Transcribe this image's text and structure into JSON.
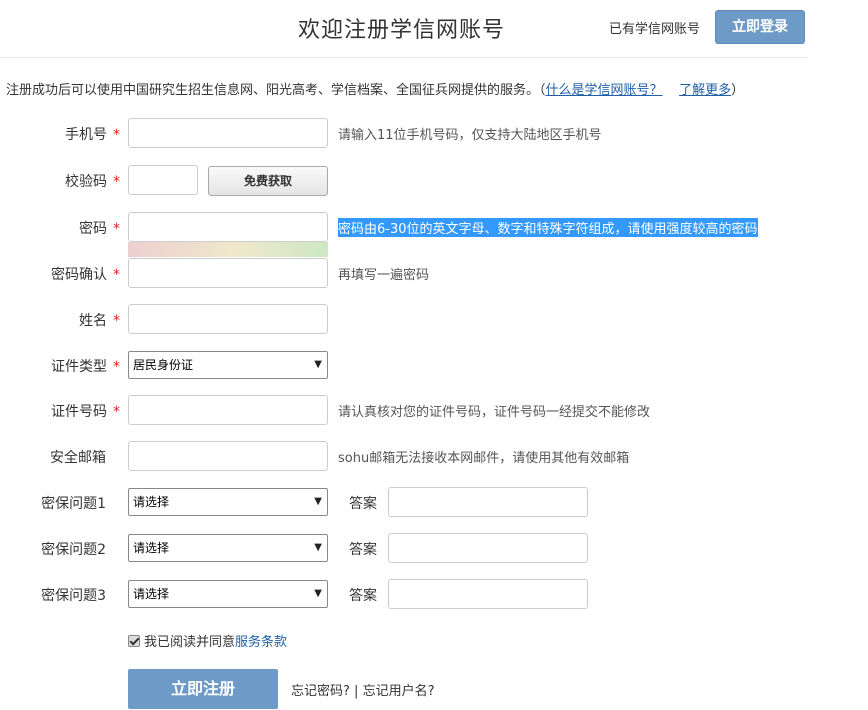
{
  "header": {
    "title": "欢迎注册学信网账号",
    "has_account": "已有学信网账号",
    "login_label": "立即登录"
  },
  "intro": {
    "text": "注册成功后可以使用中国研究生招生信息网、阳光高考、学信档案、全国征兵网提供的服务。（",
    "link_what": "什么是学信网账号？",
    "link_more": "了解更多",
    "close_paren": "）"
  },
  "form": {
    "phone": {
      "label": "手机号",
      "hint": "请输入11位手机号码，仅支持大陆地区手机号"
    },
    "code": {
      "label": "校验码",
      "button": "免费获取"
    },
    "password": {
      "label": "密码",
      "hint": "密码由6-30位的英文字母、数字和特殊字符组成，请使用强度较高的密码"
    },
    "password_confirm": {
      "label": "密码确认",
      "hint": "再填写一遍密码"
    },
    "name": {
      "label": "姓名"
    },
    "id_type": {
      "label": "证件类型",
      "selected": "居民身份证"
    },
    "id_number": {
      "label": "证件号码",
      "hint": "请认真核对您的证件号码，证件号码一经提交不能修改"
    },
    "email": {
      "label": "安全邮箱",
      "hint": "sohu邮箱无法接收本网邮件，请使用其他有效邮箱"
    },
    "questions": [
      {
        "label": "密保问题1",
        "selected": "请选择",
        "answer_label": "答案"
      },
      {
        "label": "密保问题2",
        "selected": "请选择",
        "answer_label": "答案"
      },
      {
        "label": "密保问题3",
        "selected": "请选择",
        "answer_label": "答案"
      }
    ],
    "required_mark": "*"
  },
  "agree": {
    "text": "我已阅读并同意",
    "link": "服务条款"
  },
  "register_label": "立即注册",
  "forgot": {
    "password": "忘记密码?",
    "separator": " | ",
    "username": "忘记用户名?"
  },
  "colors": {
    "primary": "#6d9ac7",
    "required": "#dd2222",
    "link": "#1e5fa8"
  }
}
